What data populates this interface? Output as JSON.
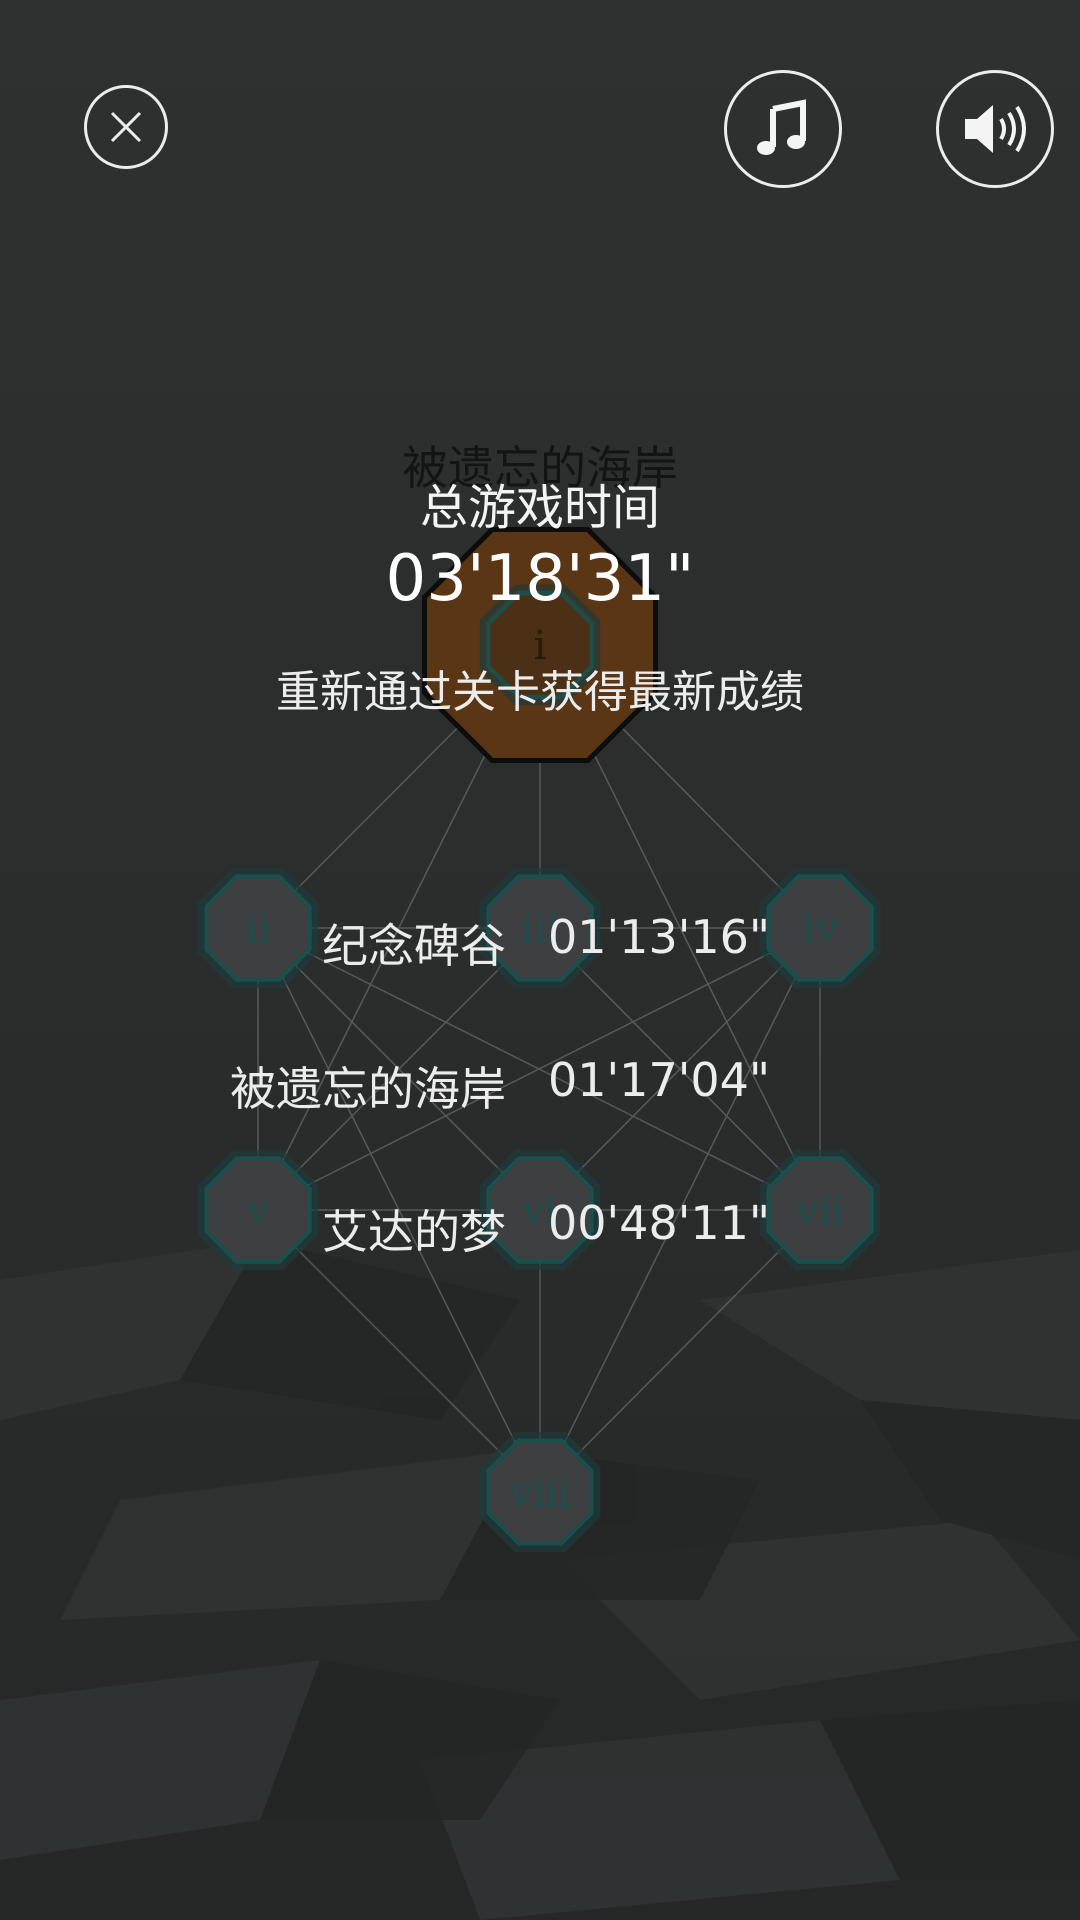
{
  "screen": {
    "level_title": "被遗忘的海岸",
    "total_label": "总游戏时间",
    "total_time": "03'18'31\"",
    "replay_hint": "重新通过关卡获得最新成绩"
  },
  "records": [
    {
      "name": "纪念碑谷",
      "time": "01'13'16\""
    },
    {
      "name": "被遗忘的海岸",
      "time": "01'17'04\""
    },
    {
      "name": "艾达的梦",
      "time": "00'48'11\""
    }
  ],
  "chapters": [
    "i",
    "ii",
    "iii",
    "iv",
    "v",
    "vi",
    "vii",
    "viii"
  ],
  "icons": {
    "close": "close-icon",
    "music": "music-note-icon",
    "sound": "speaker-icon"
  },
  "colors": {
    "background": "#2e3030",
    "node_fill": "#3d3f40",
    "node_ring": "#18504e",
    "active_node_fill": "#5a3614",
    "text": "#ececec"
  }
}
